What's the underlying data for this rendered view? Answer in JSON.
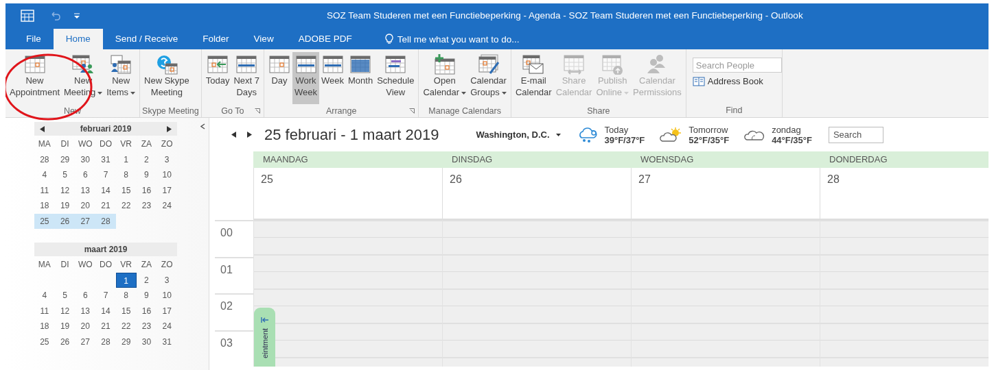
{
  "window": {
    "title": "SOZ Team Studeren met een Functiebeperking - Agenda - SOZ Team Studeren met een Functiebeperking - Outlook"
  },
  "tabs": [
    {
      "label": "File",
      "selected": false
    },
    {
      "label": "Home",
      "selected": true
    },
    {
      "label": "Send / Receive",
      "selected": false
    },
    {
      "label": "Folder",
      "selected": false
    },
    {
      "label": "View",
      "selected": false
    },
    {
      "label": "ADOBE PDF",
      "selected": false
    }
  ],
  "tell_me": {
    "label": "Tell me what you want to do..."
  },
  "ribbon": {
    "groups": [
      {
        "kind": "buttons",
        "label": "New",
        "launcher": false,
        "buttons": [
          {
            "lines": [
              "New",
              "Appointment"
            ],
            "dropdown": false
          },
          {
            "lines": [
              "New",
              "Meeting"
            ],
            "dropdown": true
          },
          {
            "lines": [
              "New",
              "Items"
            ],
            "dropdown": true
          }
        ]
      },
      {
        "kind": "buttons",
        "label": "Skype Meeting",
        "launcher": false,
        "buttons": [
          {
            "lines": [
              "New Skype",
              "Meeting"
            ],
            "dropdown": false
          }
        ]
      },
      {
        "kind": "buttons",
        "label": "Go To",
        "launcher": true,
        "buttons": [
          {
            "lines": [
              "Today"
            ],
            "dropdown": false
          },
          {
            "lines": [
              "Next 7",
              "Days"
            ],
            "dropdown": false
          }
        ]
      },
      {
        "kind": "buttons",
        "label": "Arrange",
        "launcher": true,
        "buttons": [
          {
            "lines": [
              "Day"
            ],
            "dropdown": false,
            "selected": false
          },
          {
            "lines": [
              "Work",
              "Week"
            ],
            "dropdown": false,
            "selected": true
          },
          {
            "lines": [
              "Week"
            ],
            "dropdown": false,
            "selected": false
          },
          {
            "lines": [
              "Month"
            ],
            "dropdown": false,
            "selected": false
          },
          {
            "lines": [
              "Schedule",
              "View"
            ],
            "dropdown": false,
            "selected": false
          }
        ]
      },
      {
        "kind": "buttons",
        "label": "Manage Calendars",
        "launcher": false,
        "buttons": [
          {
            "lines": [
              "Open",
              "Calendar"
            ],
            "dropdown": true
          },
          {
            "lines": [
              "Calendar",
              "Groups"
            ],
            "dropdown": true
          }
        ]
      },
      {
        "kind": "buttons",
        "label": "Share",
        "launcher": false,
        "buttons": [
          {
            "lines": [
              "E-mail",
              "Calendar"
            ],
            "dropdown": false,
            "disabled": false
          },
          {
            "lines": [
              "Share",
              "Calendar"
            ],
            "dropdown": false,
            "disabled": true
          },
          {
            "lines": [
              "Publish",
              "Online"
            ],
            "dropdown": true,
            "disabled": true
          },
          {
            "lines": [
              "Calendar",
              "Permissions"
            ],
            "dropdown": false,
            "disabled": true
          }
        ]
      },
      {
        "kind": "find",
        "label": "Find",
        "launcher": false,
        "search": {
          "placeholder": "Search People"
        },
        "link": "Address Book"
      }
    ]
  },
  "navigator": {
    "months": [
      {
        "title": "februari 2019",
        "arrows": true,
        "weekdays": [
          "MA",
          "DI",
          "WO",
          "DO",
          "VR",
          "ZA",
          "ZO"
        ],
        "weeks": [
          {
            "days": [
              {
                "day": "28",
                "selected": false,
                "today": false
              },
              {
                "day": "29",
                "selected": false,
                "today": false
              },
              {
                "day": "30",
                "selected": false,
                "today": false
              },
              {
                "day": "31",
                "selected": false,
                "today": false
              },
              {
                "day": "1",
                "selected": false,
                "today": false
              },
              {
                "day": "2",
                "selected": false,
                "today": false
              },
              {
                "day": "3",
                "selected": false,
                "today": false
              }
            ]
          },
          {
            "days": [
              {
                "day": "4",
                "selected": false,
                "today": false
              },
              {
                "day": "5",
                "selected": false,
                "today": false
              },
              {
                "day": "6",
                "selected": false,
                "today": false
              },
              {
                "day": "7",
                "selected": false,
                "today": false
              },
              {
                "day": "8",
                "selected": false,
                "today": false
              },
              {
                "day": "9",
                "selected": false,
                "today": false
              },
              {
                "day": "10",
                "selected": false,
                "today": false
              }
            ]
          },
          {
            "days": [
              {
                "day": "11",
                "selected": false,
                "today": false
              },
              {
                "day": "12",
                "selected": false,
                "today": false
              },
              {
                "day": "13",
                "selected": false,
                "today": false
              },
              {
                "day": "14",
                "selected": false,
                "today": false
              },
              {
                "day": "15",
                "selected": false,
                "today": false
              },
              {
                "day": "16",
                "selected": false,
                "today": false
              },
              {
                "day": "17",
                "selected": false,
                "today": false
              }
            ]
          },
          {
            "days": [
              {
                "day": "18",
                "selected": false,
                "today": false
              },
              {
                "day": "19",
                "selected": false,
                "today": false
              },
              {
                "day": "20",
                "selected": false,
                "today": false
              },
              {
                "day": "21",
                "selected": false,
                "today": false
              },
              {
                "day": "22",
                "selected": false,
                "today": false
              },
              {
                "day": "23",
                "selected": false,
                "today": false
              },
              {
                "day": "24",
                "selected": false,
                "today": false
              }
            ]
          },
          {
            "aligned_end": false,
            "days": [
              {
                "day": "25",
                "selected": true,
                "today": false
              },
              {
                "day": "26",
                "selected": true,
                "today": false
              },
              {
                "day": "27",
                "selected": true,
                "today": false
              },
              {
                "day": "28",
                "selected": true,
                "today": false
              }
            ]
          }
        ]
      },
      {
        "title": "maart 2019",
        "arrows": false,
        "weekdays": [
          "MA",
          "DI",
          "WO",
          "DO",
          "VR",
          "ZA",
          "ZO"
        ],
        "weeks": [
          {
            "aligned_end": true,
            "days": [
              {
                "day": "1",
                "selected": false,
                "today": true
              },
              {
                "day": "2",
                "selected": false,
                "today": false
              },
              {
                "day": "3",
                "selected": false,
                "today": false
              }
            ]
          },
          {
            "days": [
              {
                "day": "4",
                "selected": false,
                "today": false
              },
              {
                "day": "5",
                "selected": false,
                "today": false
              },
              {
                "day": "6",
                "selected": false,
                "today": false
              },
              {
                "day": "7",
                "selected": false,
                "today": false
              },
              {
                "day": "8",
                "selected": false,
                "today": false
              },
              {
                "day": "9",
                "selected": false,
                "today": false
              },
              {
                "day": "10",
                "selected": false,
                "today": false
              }
            ]
          },
          {
            "days": [
              {
                "day": "11",
                "selected": false,
                "today": false
              },
              {
                "day": "12",
                "selected": false,
                "today": false
              },
              {
                "day": "13",
                "selected": false,
                "today": false
              },
              {
                "day": "14",
                "selected": false,
                "today": false
              },
              {
                "day": "15",
                "selected": false,
                "today": false
              },
              {
                "day": "16",
                "selected": false,
                "today": false
              },
              {
                "day": "17",
                "selected": false,
                "today": false
              }
            ]
          },
          {
            "days": [
              {
                "day": "18",
                "selected": false,
                "today": false
              },
              {
                "day": "19",
                "selected": false,
                "today": false
              },
              {
                "day": "20",
                "selected": false,
                "today": false
              },
              {
                "day": "21",
                "selected": false,
                "today": false
              },
              {
                "day": "22",
                "selected": false,
                "today": false
              },
              {
                "day": "23",
                "selected": false,
                "today": false
              },
              {
                "day": "24",
                "selected": false,
                "today": false
              }
            ]
          },
          {
            "days": [
              {
                "day": "25",
                "selected": false,
                "today": false
              },
              {
                "day": "26",
                "selected": false,
                "today": false
              },
              {
                "day": "27",
                "selected": false,
                "today": false
              },
              {
                "day": "28",
                "selected": false,
                "today": false
              },
              {
                "day": "29",
                "selected": false,
                "today": false
              },
              {
                "day": "30",
                "selected": false,
                "today": false
              },
              {
                "day": "31",
                "selected": false,
                "today": false
              }
            ]
          }
        ]
      }
    ]
  },
  "calendar": {
    "range": "25 februari - 1 maart 2019",
    "location": "Washington, D.C.",
    "weather": [
      {
        "day": "Today",
        "temps": "39°F/37°F"
      },
      {
        "day": "Tomorrow",
        "temps": "52°F/35°F"
      },
      {
        "day": "zondag",
        "temps": "44°F/35°F"
      }
    ],
    "search": {
      "placeholder": "Search"
    },
    "days": [
      {
        "name": "MAANDAG",
        "date": "25"
      },
      {
        "name": "DINSDAG",
        "date": "26"
      },
      {
        "name": "WOENSDAG",
        "date": "27"
      },
      {
        "name": "DONDERDAG",
        "date": "28"
      }
    ],
    "hours": [
      "00",
      "01",
      "02",
      "03"
    ],
    "peek_tab": {
      "label": "eintment"
    }
  }
}
